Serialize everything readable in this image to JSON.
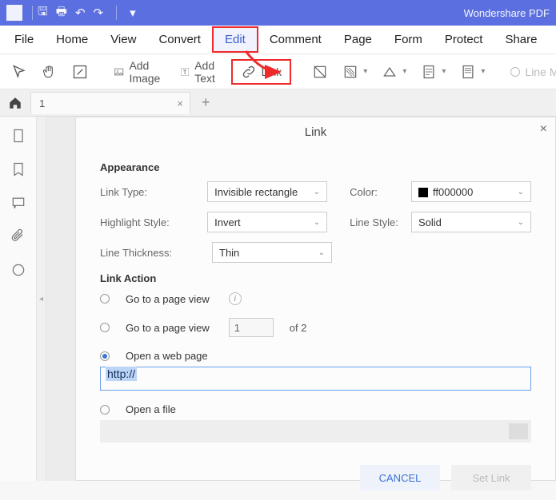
{
  "app": {
    "title": "Wondershare PDF"
  },
  "menubar": {
    "file": "File",
    "home": "Home",
    "view": "View",
    "convert": "Convert",
    "edit": "Edit",
    "comment": "Comment",
    "page": "Page",
    "form": "Form",
    "protect": "Protect",
    "share": "Share"
  },
  "toolbar": {
    "add_image": "Add Image",
    "add_text": "Add Text",
    "link": "Link",
    "line_m": "Line M"
  },
  "tabs": {
    "first": "1"
  },
  "dialog": {
    "title": "Link",
    "appearance": {
      "heading": "Appearance",
      "link_type_label": "Link Type:",
      "link_type_value": "Invisible rectangle",
      "highlight_label": "Highlight Style:",
      "highlight_value": "Invert",
      "thickness_label": "Line Thickness:",
      "thickness_value": "Thin",
      "color_label": "Color:",
      "color_value": "ff000000",
      "linestyle_label": "Line Style:",
      "linestyle_value": "Solid"
    },
    "action": {
      "heading": "Link Action",
      "goto_view": "Go to a page view",
      "goto_page": "Go to a page view",
      "page_input": "1",
      "of_text": "of 2",
      "open_web": "Open a web page",
      "url_value": "http://",
      "open_file": "Open a file"
    },
    "buttons": {
      "cancel": "CANCEL",
      "set": "Set Link"
    }
  }
}
